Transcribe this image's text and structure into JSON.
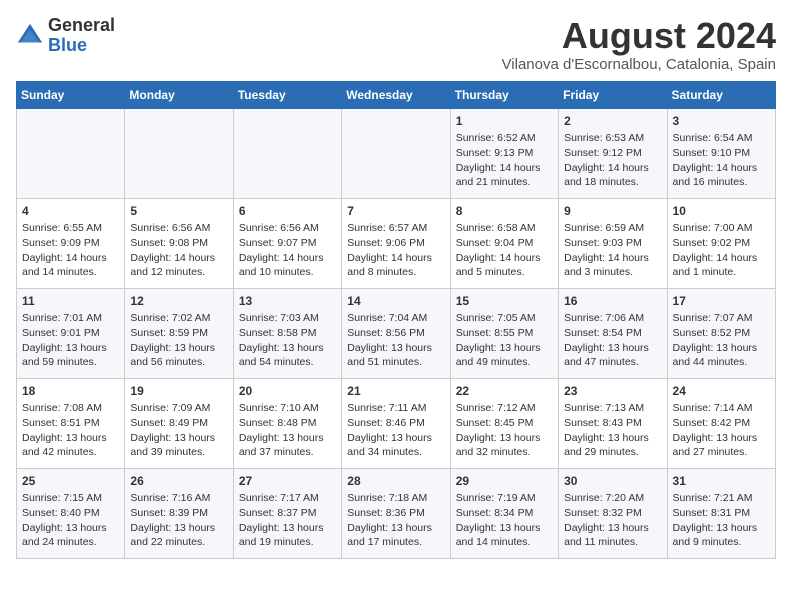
{
  "header": {
    "logo": {
      "general": "General",
      "blue": "Blue"
    },
    "title": "August 2024",
    "location": "Vilanova d'Escornalbou, Catalonia, Spain"
  },
  "days_of_week": [
    "Sunday",
    "Monday",
    "Tuesday",
    "Wednesday",
    "Thursday",
    "Friday",
    "Saturday"
  ],
  "weeks": [
    [
      {
        "day": "",
        "info": ""
      },
      {
        "day": "",
        "info": ""
      },
      {
        "day": "",
        "info": ""
      },
      {
        "day": "",
        "info": ""
      },
      {
        "day": "1",
        "info": "Sunrise: 6:52 AM\nSunset: 9:13 PM\nDaylight: 14 hours\nand 21 minutes."
      },
      {
        "day": "2",
        "info": "Sunrise: 6:53 AM\nSunset: 9:12 PM\nDaylight: 14 hours\nand 18 minutes."
      },
      {
        "day": "3",
        "info": "Sunrise: 6:54 AM\nSunset: 9:10 PM\nDaylight: 14 hours\nand 16 minutes."
      }
    ],
    [
      {
        "day": "4",
        "info": "Sunrise: 6:55 AM\nSunset: 9:09 PM\nDaylight: 14 hours\nand 14 minutes."
      },
      {
        "day": "5",
        "info": "Sunrise: 6:56 AM\nSunset: 9:08 PM\nDaylight: 14 hours\nand 12 minutes."
      },
      {
        "day": "6",
        "info": "Sunrise: 6:56 AM\nSunset: 9:07 PM\nDaylight: 14 hours\nand 10 minutes."
      },
      {
        "day": "7",
        "info": "Sunrise: 6:57 AM\nSunset: 9:06 PM\nDaylight: 14 hours\nand 8 minutes."
      },
      {
        "day": "8",
        "info": "Sunrise: 6:58 AM\nSunset: 9:04 PM\nDaylight: 14 hours\nand 5 minutes."
      },
      {
        "day": "9",
        "info": "Sunrise: 6:59 AM\nSunset: 9:03 PM\nDaylight: 14 hours\nand 3 minutes."
      },
      {
        "day": "10",
        "info": "Sunrise: 7:00 AM\nSunset: 9:02 PM\nDaylight: 14 hours\nand 1 minute."
      }
    ],
    [
      {
        "day": "11",
        "info": "Sunrise: 7:01 AM\nSunset: 9:01 PM\nDaylight: 13 hours\nand 59 minutes."
      },
      {
        "day": "12",
        "info": "Sunrise: 7:02 AM\nSunset: 8:59 PM\nDaylight: 13 hours\nand 56 minutes."
      },
      {
        "day": "13",
        "info": "Sunrise: 7:03 AM\nSunset: 8:58 PM\nDaylight: 13 hours\nand 54 minutes."
      },
      {
        "day": "14",
        "info": "Sunrise: 7:04 AM\nSunset: 8:56 PM\nDaylight: 13 hours\nand 51 minutes."
      },
      {
        "day": "15",
        "info": "Sunrise: 7:05 AM\nSunset: 8:55 PM\nDaylight: 13 hours\nand 49 minutes."
      },
      {
        "day": "16",
        "info": "Sunrise: 7:06 AM\nSunset: 8:54 PM\nDaylight: 13 hours\nand 47 minutes."
      },
      {
        "day": "17",
        "info": "Sunrise: 7:07 AM\nSunset: 8:52 PM\nDaylight: 13 hours\nand 44 minutes."
      }
    ],
    [
      {
        "day": "18",
        "info": "Sunrise: 7:08 AM\nSunset: 8:51 PM\nDaylight: 13 hours\nand 42 minutes."
      },
      {
        "day": "19",
        "info": "Sunrise: 7:09 AM\nSunset: 8:49 PM\nDaylight: 13 hours\nand 39 minutes."
      },
      {
        "day": "20",
        "info": "Sunrise: 7:10 AM\nSunset: 8:48 PM\nDaylight: 13 hours\nand 37 minutes."
      },
      {
        "day": "21",
        "info": "Sunrise: 7:11 AM\nSunset: 8:46 PM\nDaylight: 13 hours\nand 34 minutes."
      },
      {
        "day": "22",
        "info": "Sunrise: 7:12 AM\nSunset: 8:45 PM\nDaylight: 13 hours\nand 32 minutes."
      },
      {
        "day": "23",
        "info": "Sunrise: 7:13 AM\nSunset: 8:43 PM\nDaylight: 13 hours\nand 29 minutes."
      },
      {
        "day": "24",
        "info": "Sunrise: 7:14 AM\nSunset: 8:42 PM\nDaylight: 13 hours\nand 27 minutes."
      }
    ],
    [
      {
        "day": "25",
        "info": "Sunrise: 7:15 AM\nSunset: 8:40 PM\nDaylight: 13 hours\nand 24 minutes."
      },
      {
        "day": "26",
        "info": "Sunrise: 7:16 AM\nSunset: 8:39 PM\nDaylight: 13 hours\nand 22 minutes."
      },
      {
        "day": "27",
        "info": "Sunrise: 7:17 AM\nSunset: 8:37 PM\nDaylight: 13 hours\nand 19 minutes."
      },
      {
        "day": "28",
        "info": "Sunrise: 7:18 AM\nSunset: 8:36 PM\nDaylight: 13 hours\nand 17 minutes."
      },
      {
        "day": "29",
        "info": "Sunrise: 7:19 AM\nSunset: 8:34 PM\nDaylight: 13 hours\nand 14 minutes."
      },
      {
        "day": "30",
        "info": "Sunrise: 7:20 AM\nSunset: 8:32 PM\nDaylight: 13 hours\nand 11 minutes."
      },
      {
        "day": "31",
        "info": "Sunrise: 7:21 AM\nSunset: 8:31 PM\nDaylight: 13 hours\nand 9 minutes."
      }
    ]
  ]
}
